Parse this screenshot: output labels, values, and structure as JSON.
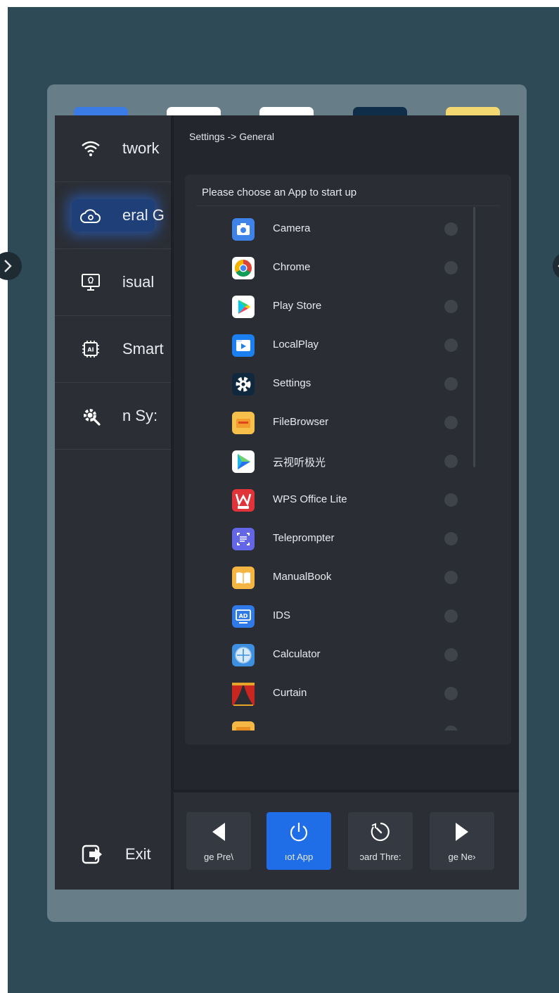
{
  "breadcrumb": "Settings -> General",
  "sidebar": {
    "items": [
      {
        "label": "twork",
        "icon": "wifi-icon"
      },
      {
        "label": "eral  G",
        "icon": "cloud-gear-icon",
        "active": true
      },
      {
        "label": "isual",
        "icon": "monitor-bulb-icon"
      },
      {
        "label": "Smart",
        "icon": "ai-chip-icon"
      },
      {
        "label": "n  Sy:",
        "icon": "gear-wrench-icon"
      }
    ],
    "exit_label": "Exit"
  },
  "card": {
    "title": "Please choose an App to start up",
    "apps": [
      {
        "name": "Camera",
        "icon": "camera-icon"
      },
      {
        "name": "Chrome",
        "icon": "chrome-icon"
      },
      {
        "name": "Play Store",
        "icon": "play-store-icon"
      },
      {
        "name": "LocalPlay",
        "icon": "local-play-icon"
      },
      {
        "name": "Settings",
        "icon": "settings-gear-icon"
      },
      {
        "name": "FileBrowser",
        "icon": "file-browser-icon"
      },
      {
        "name": "云视听极光",
        "icon": "video-play-icon"
      },
      {
        "name": "WPS Office Lite",
        "icon": "wps-icon"
      },
      {
        "name": "Teleprompter",
        "icon": "teleprompter-icon"
      },
      {
        "name": "ManualBook",
        "icon": "manual-book-icon"
      },
      {
        "name": "IDS",
        "icon": "ids-icon"
      },
      {
        "name": "Calculator",
        "icon": "calculator-icon"
      },
      {
        "name": "Curtain",
        "icon": "curtain-icon"
      },
      {
        "name": "",
        "icon": "folder-icon"
      }
    ]
  },
  "bottom_nav": [
    {
      "label": "ge   Pre\\",
      "icon": "triangle-left-icon"
    },
    {
      "label": "ıot App",
      "icon": "power-icon",
      "active": true
    },
    {
      "label": "ɔard Thre:",
      "icon": "timer-icon"
    },
    {
      "label": "ge    Ne›",
      "icon": "triangle-right-icon"
    }
  ],
  "colors": {
    "accent": "#1f6ee8",
    "background": "#2e4a57",
    "panel": "#23262c"
  }
}
